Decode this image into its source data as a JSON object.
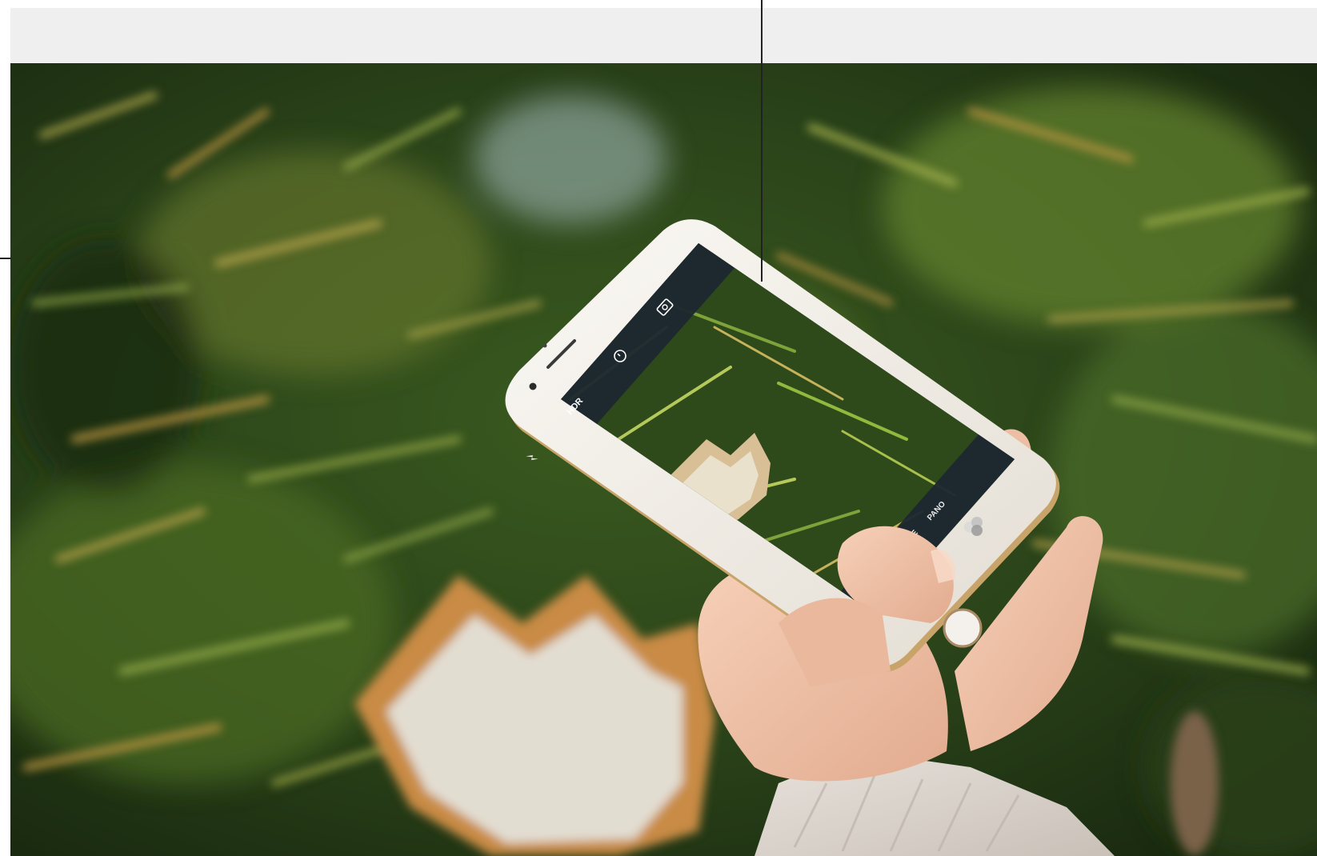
{
  "photo": {
    "subject": "hand-holding-phone-photographing-leaf",
    "colors": {
      "grass_dark": "#1f3314",
      "grass_mid": "#3f6a22",
      "grass_light": "#8fa646",
      "straw": "#c69a45",
      "frost": "#e6ebea",
      "leaf": "#c98b45",
      "skin": "#f0c3a8",
      "sleeve": "#ddd6d0",
      "phone_body": "#f4f1ec"
    }
  },
  "phone_ui": {
    "hdr_label": "HDR",
    "pano_label": "PANO",
    "mode_partial_label": "E",
    "flash_icon": "flash-icon",
    "timer_icon": "timer-icon",
    "switch_camera_icon": "switch-camera-icon",
    "filters_icon": "filters-icon"
  }
}
